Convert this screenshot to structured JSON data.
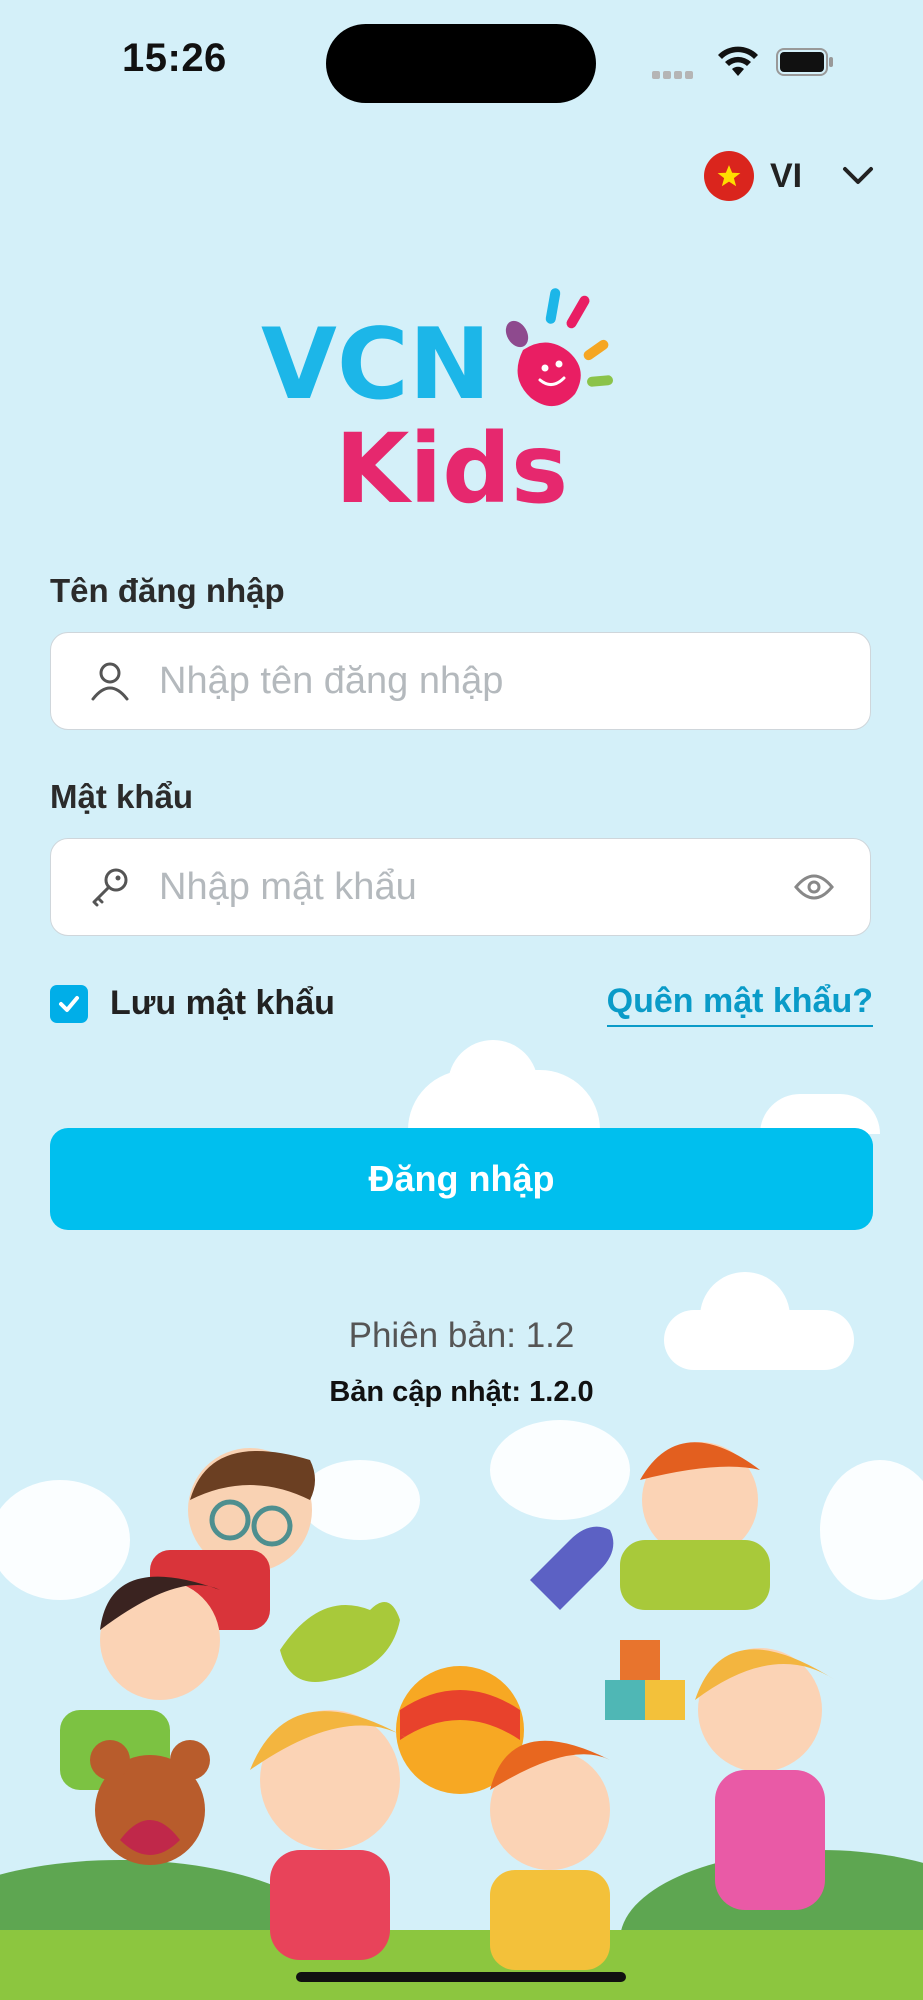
{
  "status_bar": {
    "time": "15:26"
  },
  "language": {
    "code": "VI",
    "flag_icon": "vietnam-flag-icon"
  },
  "logo": {
    "line1": "VCN",
    "line2": "Kids"
  },
  "username": {
    "label": "Tên đăng nhập",
    "placeholder": "Nhập tên đăng nhập",
    "value": ""
  },
  "password": {
    "label": "Mật khẩu",
    "placeholder": "Nhập mật khẩu",
    "value": ""
  },
  "remember": {
    "label": "Lưu mật khẩu",
    "checked": true
  },
  "forgot_label": "Quên mật khẩu?",
  "login_label": "Đăng nhập",
  "version_text": "Phiên bản: 1.2",
  "update_text": "Bản cập nhật: 1.2.0",
  "colors": {
    "accent": "#00bfee",
    "background": "#d4f0f9",
    "link": "#0a9bc8"
  }
}
